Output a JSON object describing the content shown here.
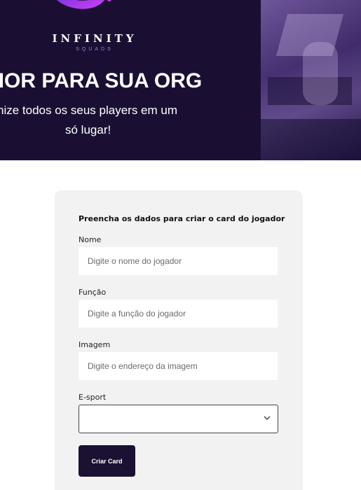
{
  "hero": {
    "logo_title": "INFINITY",
    "logo_subtitle": "SQUADS",
    "headline": "LHOR PARA SUA ORG",
    "tagline_line1": "nize todos os seus players em um",
    "tagline_line2": "só lugar!",
    "background_color": "#1a0f33",
    "logo_accent_color": "#8a3df0"
  },
  "form": {
    "heading": "Preencha os dados para criar o card do jogador",
    "fields": {
      "nome": {
        "label": "Nome",
        "placeholder": "Digite o nome do jogador",
        "value": ""
      },
      "funcao": {
        "label": "Função",
        "placeholder": "Digite a função do jogador",
        "value": ""
      },
      "imagem": {
        "label": "Imagem",
        "placeholder": "Digite o endereço da imagem",
        "value": ""
      },
      "esport": {
        "label": "E-sport",
        "selected": ""
      }
    },
    "submit_label": "Criar Card",
    "card_background": "#f2f2f2",
    "button_color": "#1a1133"
  },
  "icons": {
    "logo": "infinity-logo-icon",
    "select_chevron": "chevron-down-icon"
  }
}
